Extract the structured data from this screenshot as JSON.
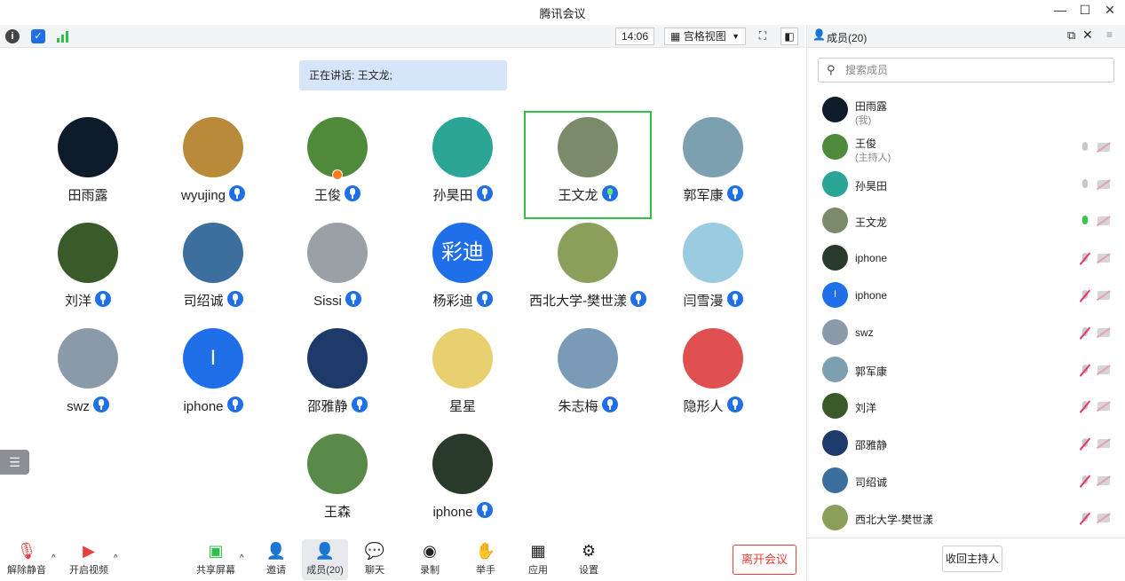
{
  "window": {
    "title": "腾讯会议",
    "minimize": "—",
    "maximize": "☐",
    "close": "✕"
  },
  "toolbar": {
    "time": "14:06",
    "view_label": "宫格视图"
  },
  "speaking": {
    "text": "正在讲话: 王文龙;"
  },
  "colors": {
    "accent": "#1e6fe8",
    "active_speaker": "#2fc04a",
    "leave": "#e6403c"
  },
  "tiles": [
    {
      "name": "田雨露",
      "mic": false,
      "avatar_color": "#0d1b2a"
    },
    {
      "name": "wyujing",
      "mic": true,
      "avatar_color": "#b88a3a"
    },
    {
      "name": "王俊",
      "mic": true,
      "host": true,
      "avatar_color": "#4e8a3a"
    },
    {
      "name": "孙昊田",
      "mic": true,
      "avatar_color": "#2aa596"
    },
    {
      "name": "王文龙",
      "mic": true,
      "speaking": true,
      "avatar_color": "#7a8a6a"
    },
    {
      "name": "郭军康",
      "mic": true,
      "avatar_color": "#7da0b0"
    },
    {
      "name": "刘洋",
      "mic": true,
      "avatar_color": "#3a5a2a"
    },
    {
      "name": "司绍诚",
      "mic": true,
      "avatar_color": "#3c6e9e"
    },
    {
      "name": "Sissi",
      "mic": true,
      "avatar_color": "#9aa0a6"
    },
    {
      "name": "杨彩迪",
      "mic": true,
      "avatar_color": "#1e6fe8",
      "avatar_text": "彩迪"
    },
    {
      "name": "西北大学-樊世漾",
      "mic": true,
      "avatar_color": "#8aa05a"
    },
    {
      "name": "闫雪漫",
      "mic": true,
      "avatar_color": "#9acbe0"
    },
    {
      "name": "swz",
      "mic": true,
      "avatar_color": "#8a9aa8"
    },
    {
      "name": "iphone",
      "mic": true,
      "avatar_color": "#1e6fe8",
      "avatar_text": "I"
    },
    {
      "name": "邵雅静",
      "mic": true,
      "avatar_color": "#1e3a6a"
    },
    {
      "name": "星星",
      "mic": false,
      "avatar_color": "#e8d070"
    },
    {
      "name": "朱志梅",
      "mic": true,
      "avatar_color": "#7a9ab8"
    },
    {
      "name": "隐形人",
      "mic": true,
      "avatar_color": "#e05050"
    },
    {
      "name": "王森",
      "mic": false,
      "avatar_color": "#5a8a4a"
    },
    {
      "name": "iphone",
      "mic": true,
      "avatar_color": "#2a3a2a"
    }
  ],
  "bottombar": {
    "unmute": "解除静音",
    "video": "开启视频",
    "share": "共享屏幕",
    "invite": "邀请",
    "members": "成员(20)",
    "chat": "聊天",
    "record": "录制",
    "raise_hand": "举手",
    "apps": "应用",
    "settings": "设置",
    "leave": "离开会议"
  },
  "panel": {
    "title": "成员(20)",
    "search_placeholder": "搜索成员",
    "reclaim_host": "收回主持人",
    "members": [
      {
        "name": "田雨露",
        "sub": "(我)",
        "avatar_color": "#0d1b2a",
        "mic_state": "none"
      },
      {
        "name": "王俊",
        "sub": "(主持人)",
        "avatar_color": "#4e8a3a",
        "mic_state": "off"
      },
      {
        "name": "孙昊田",
        "sub": "",
        "avatar_color": "#2aa596",
        "mic_state": "off"
      },
      {
        "name": "王文龙",
        "sub": "",
        "avatar_color": "#7a8a6a",
        "mic_state": "on"
      },
      {
        "name": "iphone",
        "sub": "",
        "avatar_color": "#2a3a2a",
        "mic_state": "muted"
      },
      {
        "name": "iphone",
        "sub": "",
        "avatar_color": "#1e6fe8",
        "avatar_text": "I",
        "mic_state": "muted"
      },
      {
        "name": "swz",
        "sub": "",
        "avatar_color": "#8a9aa8",
        "mic_state": "muted"
      },
      {
        "name": "郭军康",
        "sub": "",
        "avatar_color": "#7da0b0",
        "mic_state": "muted"
      },
      {
        "name": "刘洋",
        "sub": "",
        "avatar_color": "#3a5a2a",
        "mic_state": "muted"
      },
      {
        "name": "邵雅静",
        "sub": "",
        "avatar_color": "#1e3a6a",
        "mic_state": "muted"
      },
      {
        "name": "司绍诚",
        "sub": "",
        "avatar_color": "#3c6e9e",
        "mic_state": "muted"
      },
      {
        "name": "西北大学-樊世漾",
        "sub": "",
        "avatar_color": "#8aa05a",
        "mic_state": "muted"
      }
    ]
  }
}
